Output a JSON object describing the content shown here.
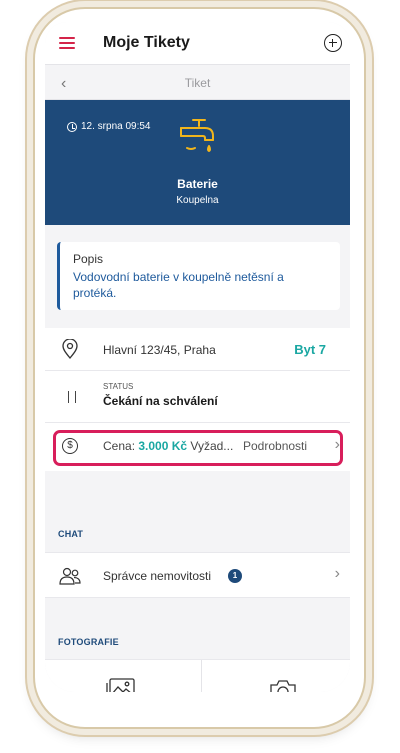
{
  "header": {
    "title": "Moje Tikety"
  },
  "subheader": {
    "back_icon": "‹",
    "title": "Tiket"
  },
  "ticket": {
    "date": "12. srpna 09:54",
    "item": "Baterie",
    "room": "Koupelna",
    "icon": "faucet-icon"
  },
  "description": {
    "label": "Popis",
    "text": "Vodovodní baterie v koupelně netěsní a protéká."
  },
  "location": {
    "address": "Hlavní 123/45, Praha",
    "unit": "Byt 7"
  },
  "status": {
    "label": "STATUS",
    "value": "Čekání na schválení"
  },
  "price": {
    "icon": "$",
    "prefix": "Cena: ",
    "amount": "3.000 Kč",
    "suffix": " Vyžad...",
    "details_label": "Podrobnosti",
    "chevron": "›"
  },
  "chat": {
    "section_label": "CHAT",
    "contact": "Správce nemovitosti",
    "unread": "1",
    "chevron": "›"
  },
  "photos": {
    "section_label": "FOTOGRAFIE"
  },
  "colors": {
    "accent": "#1e4a7a",
    "highlight": "#d81e5b",
    "teal": "#1aa7a2",
    "brand": "#d42449"
  }
}
